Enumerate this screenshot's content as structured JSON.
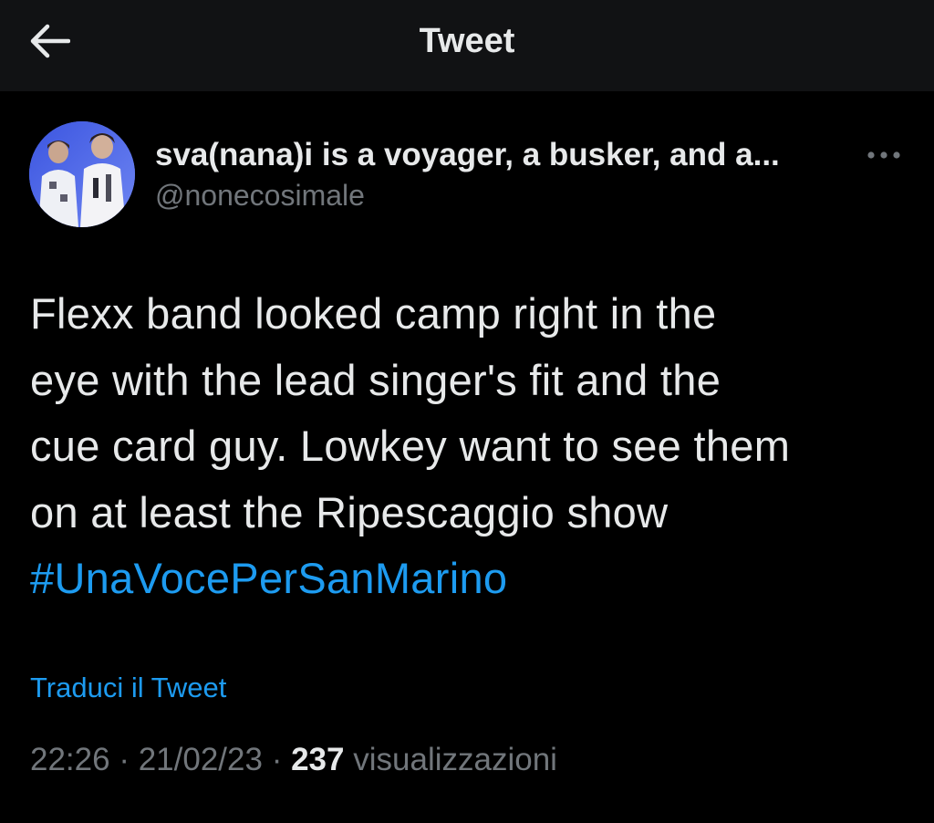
{
  "header": {
    "title": "Tweet",
    "back_icon": "arrow-left-icon"
  },
  "tweet": {
    "author": {
      "display_name": "sva(nana)i is a voyager, a busker, and a...",
      "handle": "@nonecosimale",
      "avatar_icon": "avatar-photo"
    },
    "more_icon": "more-options-icon",
    "text_lines": [
      "Flexx band looked camp right in the",
      "eye with the lead singer's fit and the",
      "cue card guy. Lowkey want to see them",
      "on at least the Ripescaggio show"
    ],
    "hashtag": "#UnaVocePerSanMarino",
    "translate_label": "Traduci il Tweet",
    "time": "22:26",
    "date": "21/02/23",
    "separator": "·",
    "views_count": "237",
    "views_label": "visualizzazioni"
  },
  "colors": {
    "background": "#000000",
    "header_background": "#111214",
    "text_primary": "#e7e9ea",
    "text_secondary": "#71767b",
    "accent": "#1d9bf0"
  }
}
